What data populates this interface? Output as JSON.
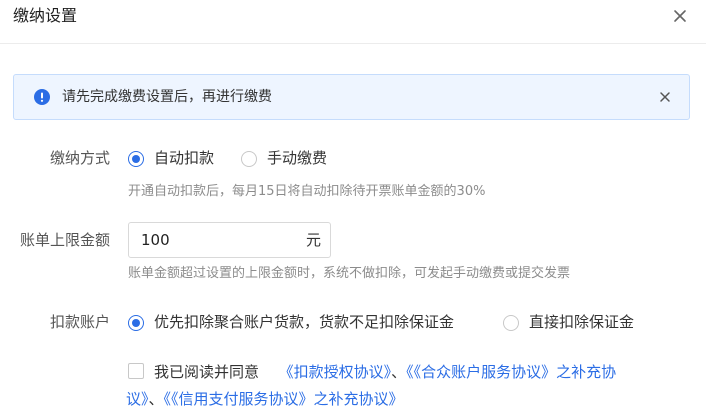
{
  "dialog": {
    "title": "缴纳设置"
  },
  "alert": {
    "text": "请先完成缴费设置后，再进行缴费"
  },
  "payment_method": {
    "label": "缴纳方式",
    "options": [
      {
        "label": "自动扣款",
        "selected": true
      },
      {
        "label": "手动缴费",
        "selected": false
      }
    ],
    "hint": "开通自动扣款后，每月15日将自动扣除待开票账单金额的30%"
  },
  "bill_limit": {
    "label": "账单上限金额",
    "value": "100",
    "unit": "元",
    "hint": "账单金额超过设置的上限金额时，系统不做扣除，可发起手动缴费或提交发票"
  },
  "deduct_account": {
    "label": "扣款账户",
    "options": [
      {
        "label": "优先扣除聚合账户货款，货款不足扣除保证金",
        "selected": true
      },
      {
        "label": "直接扣除保证金",
        "selected": false
      }
    ]
  },
  "agreement": {
    "checked": false,
    "prefix": "我已阅读并同意",
    "link1": "《扣款授权协议》",
    "sep1": "、",
    "link2": "《《合众账户服务协议》之补充协",
    "link2_cont": "议》",
    "sep2": "、",
    "link3": "《《信用支付服务协议》之补充协议》"
  },
  "colors": {
    "accent": "#2b6de5",
    "alert_bg": "#eef5ff",
    "alert_border": "#c5dcfc"
  },
  "icons": {
    "close": "close-icon",
    "info": "info-circle-icon",
    "alert_close": "close-icon"
  }
}
